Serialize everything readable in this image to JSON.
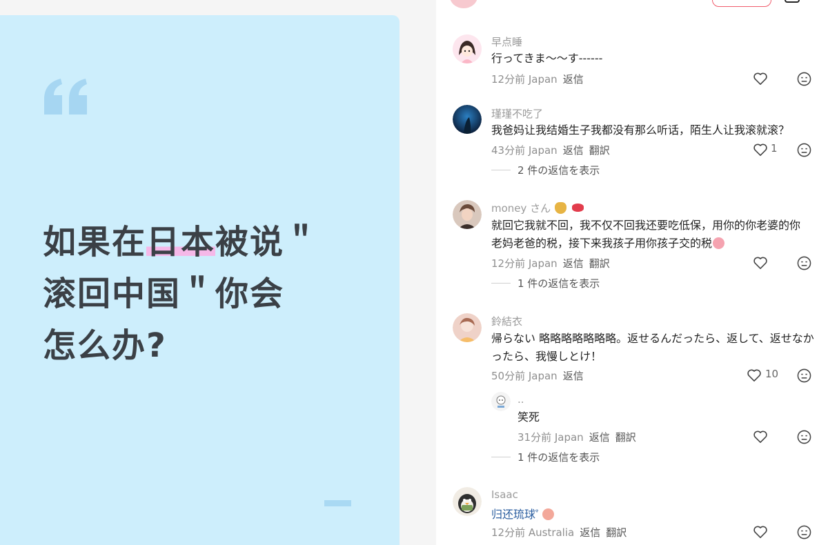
{
  "post": {
    "line1_pre": "如果在",
    "line1_hl": "日本",
    "line1_post": "被说＂",
    "line2": "滚回中国＂你会",
    "line3": "怎么办?"
  },
  "comments": [
    {
      "name": "早点睡",
      "text": "行ってきま〜〜す------",
      "time": "12分前 Japan",
      "reply_label": "返信",
      "translate_label": "",
      "likes": ""
    },
    {
      "name": "瑾瑾不吃了",
      "text": "我爸妈让我结婚生子我都没有那么听话，陌生人让我滚就滚？",
      "time": "43分前 Japan",
      "reply_label": "返信",
      "translate_label": "翻訳",
      "likes": "1",
      "view_replies": "2 件の返信を表示"
    },
    {
      "name": "money さん",
      "text_line1": "就回它我就不回，我不仅不回我还要吃低保，用你的你老婆的你",
      "text_line2": "老妈老爸的税，接下来我孩子用你孩子交的税",
      "time": "12分前 Japan",
      "reply_label": "返信",
      "translate_label": "翻訳",
      "likes": "",
      "view_replies": "1 件の返信を表示"
    },
    {
      "name": "鈴結衣",
      "text_line1": "帰らない 略略略略略略略。返せるんだったら、返して、返せなか",
      "text_line2": "ったら、我慢しとけ！",
      "time": "50分前 Japan",
      "reply_label": "返信",
      "translate_label": "",
      "likes": "10"
    },
    {
      "name": "..",
      "text": "笑死",
      "time": "31分前 Japan",
      "reply_label": "返信",
      "translate_label": "翻訳",
      "likes": "",
      "view_replies": "1 件の返信を表示"
    },
    {
      "name": "Isaac",
      "text": "归还琉球",
      "time": "12分前 Australia",
      "reply_label": "返信",
      "translate_label": "翻訳",
      "likes": ""
    }
  ],
  "colors": {
    "card_bg": "#cdeefc",
    "highlight": "#f5b8e8",
    "link_text": "#2a5d9f",
    "follow_border": "#f05b6b"
  },
  "icons": [
    "quote-icon",
    "heart-icon",
    "dislike-face-icon",
    "money-bag-emoji",
    "lips-emoji",
    "pig-emoji",
    "peach-emoji"
  ]
}
